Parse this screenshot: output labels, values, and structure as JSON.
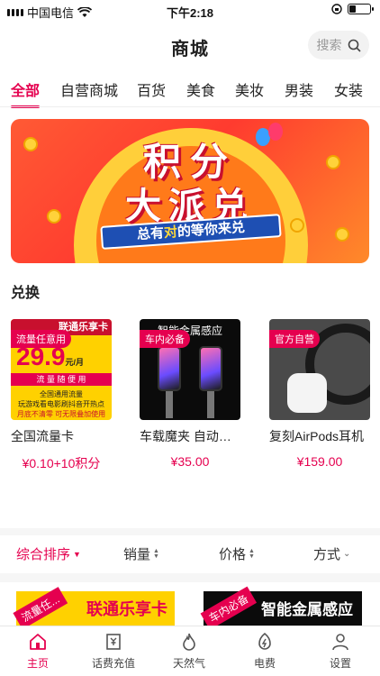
{
  "status_bar": {
    "carrier": "中国电信",
    "time": "下午2:18",
    "battery_level": 0.3
  },
  "header": {
    "title": "商城",
    "search_label": "搜索"
  },
  "tabs": [
    {
      "label": "全部",
      "active": true
    },
    {
      "label": "自营商城"
    },
    {
      "label": "百货"
    },
    {
      "label": "美食"
    },
    {
      "label": "美妆"
    },
    {
      "label": "男装"
    },
    {
      "label": "女装"
    }
  ],
  "banner": {
    "line1": "积分",
    "line2": "大派兑",
    "ribbon_pre": "总有",
    "ribbon_mid": "对",
    "ribbon_post": "的等你来兑"
  },
  "section": {
    "title": "兑换"
  },
  "products": [
    {
      "tag": "流量任意用",
      "name": "全国流量卡",
      "price": "¥0.10+10积分",
      "image": {
        "top": "联通乐享卡",
        "big": "29.9",
        "unit": "元/月",
        "band": "流 量 随 便 用",
        "line1": "全国通用流量",
        "line2": "玩游戏看电影刷抖音开热点",
        "line3": "月底不清零  可无限叠加使用"
      }
    },
    {
      "tag": "车内必备",
      "name": "车载魔夹 自动感应",
      "price": "¥35.00",
      "image": {
        "header": "智能金属感应"
      }
    },
    {
      "tag": "官方自营",
      "name": "复刻AirPods耳机",
      "price": "¥159.00",
      "image": {}
    }
  ],
  "sort": [
    {
      "label": "综合排序",
      "active": true
    },
    {
      "label": "销量"
    },
    {
      "label": "价格"
    },
    {
      "label": "方式"
    }
  ],
  "preview_cards": [
    {
      "tag": "流量任...",
      "header": "联通乐享卡"
    },
    {
      "tag": "车内必备",
      "header": "智能金属感应"
    }
  ],
  "tabbar": [
    {
      "label": "主页",
      "icon": "home-icon",
      "active": true
    },
    {
      "label": "话费充值",
      "icon": "bill-icon"
    },
    {
      "label": "天然气",
      "icon": "flame-icon"
    },
    {
      "label": "电费",
      "icon": "lightning-icon"
    },
    {
      "label": "设置",
      "icon": "person-icon"
    }
  ],
  "colors": {
    "accent": "#e5004f",
    "unicom_yellow": "#ffd100",
    "ribbon_blue": "#1e4fb3"
  }
}
